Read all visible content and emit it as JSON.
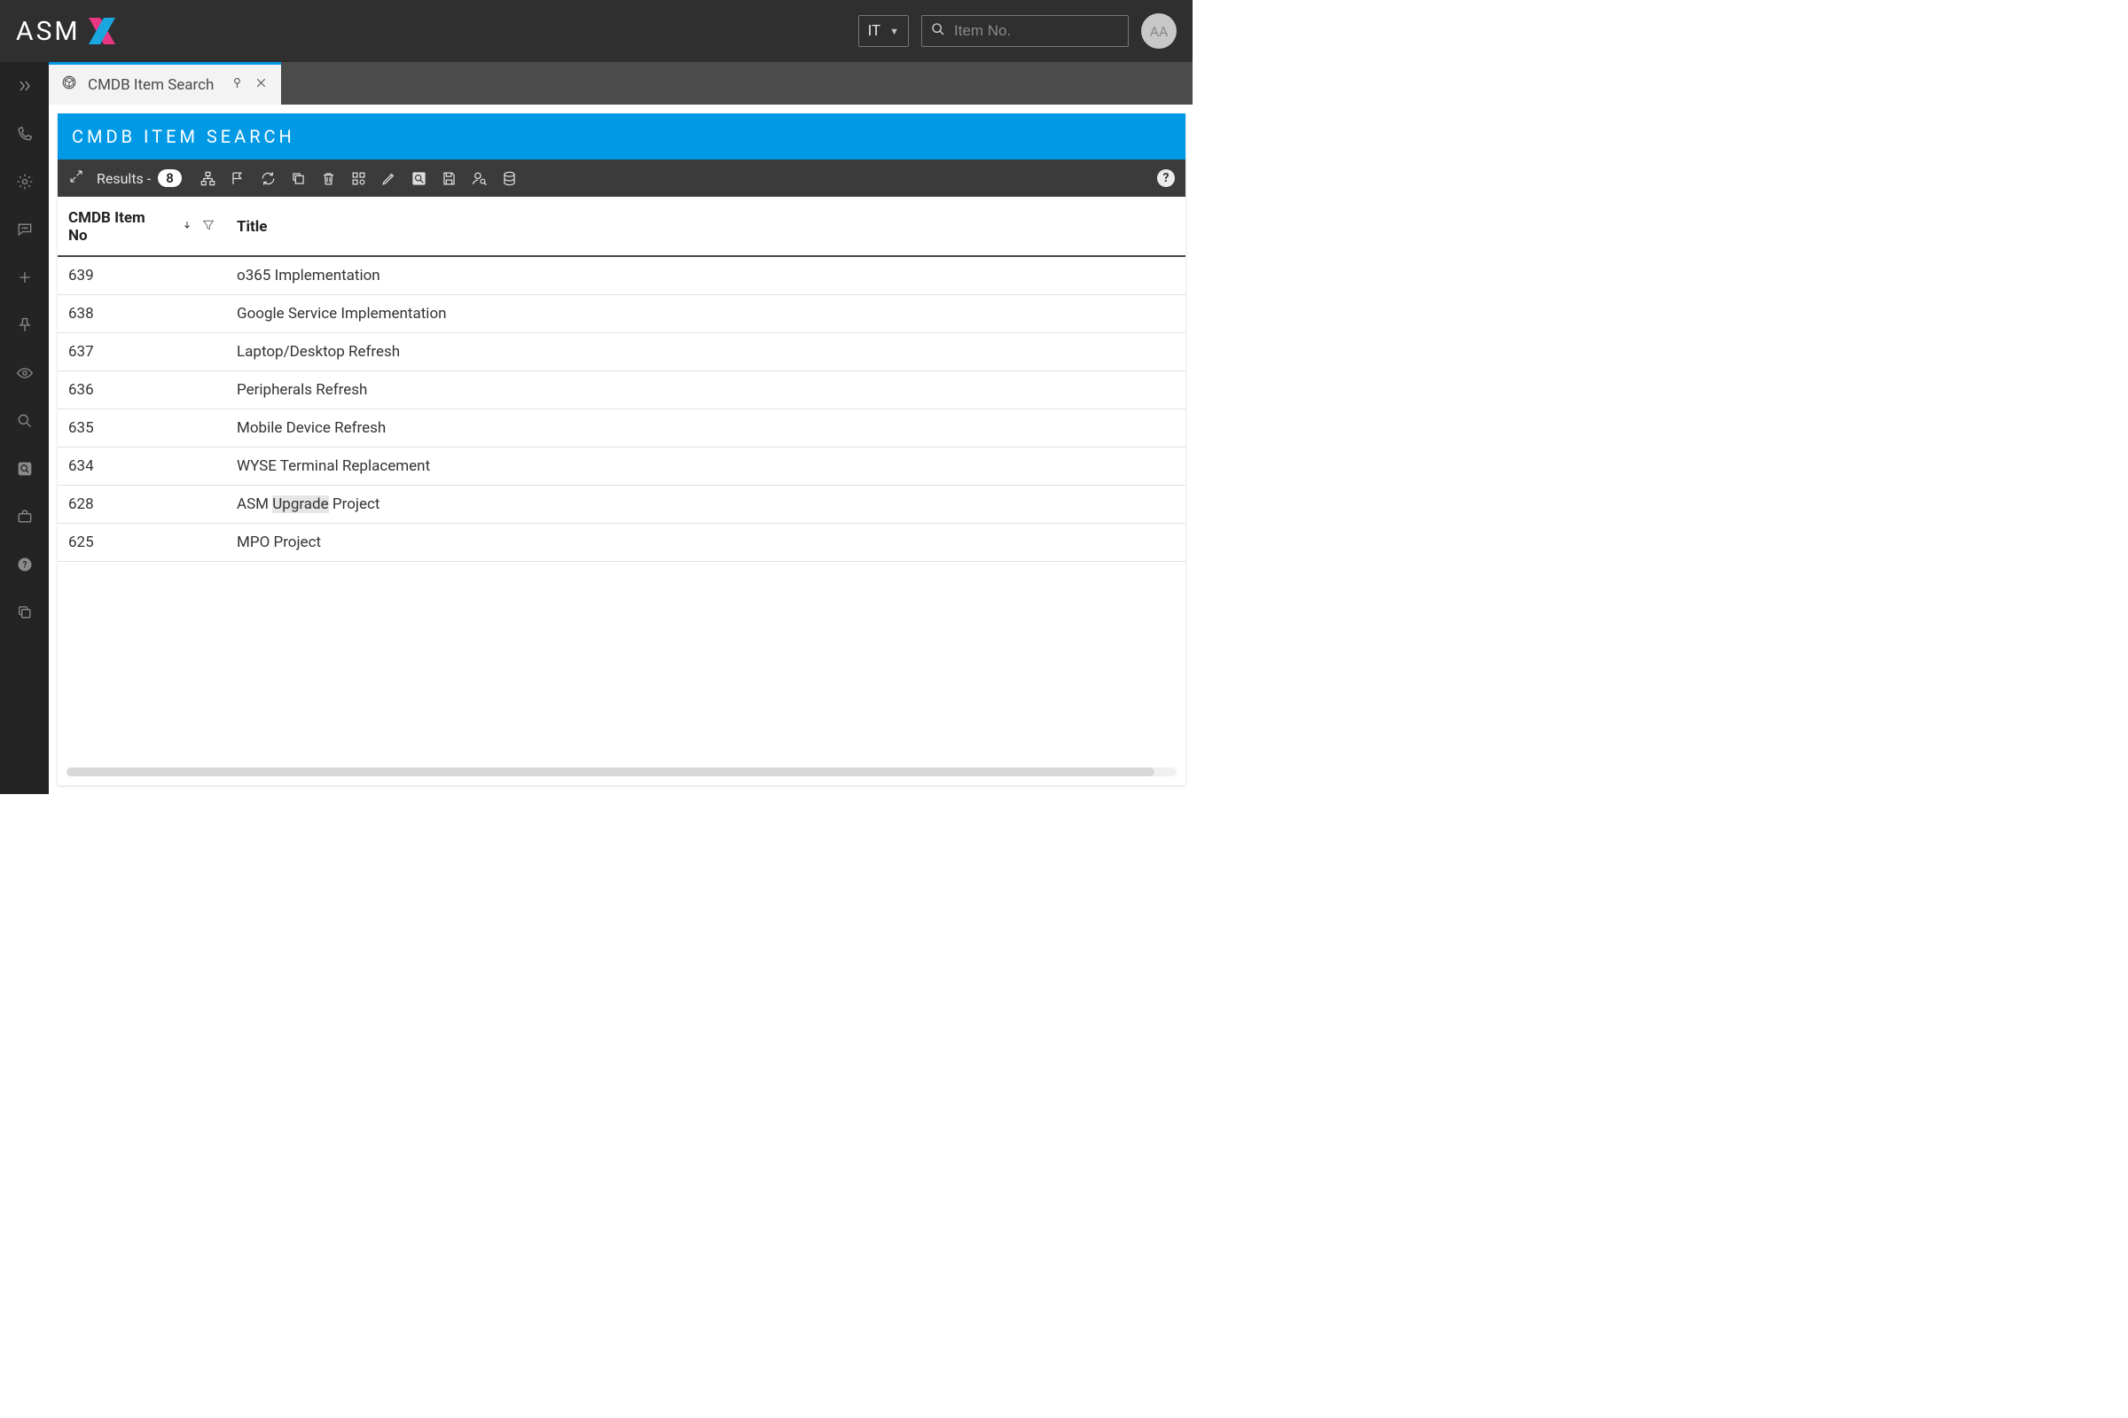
{
  "topbar": {
    "logo_text": "ASM",
    "dropdown_value": "IT",
    "search_placeholder": "Item No.",
    "avatar_initials": "AA"
  },
  "tab": {
    "label": "CMDB Item Search"
  },
  "panel": {
    "title": "CMDB ITEM SEARCH"
  },
  "toolbar": {
    "results_label": "Results -",
    "results_count": "8"
  },
  "table": {
    "columns": {
      "no": "CMDB Item No",
      "title": "Title"
    },
    "rows": [
      {
        "no": "639",
        "title": "o365 Implementation"
      },
      {
        "no": "638",
        "title": "Google Service Implementation"
      },
      {
        "no": "637",
        "title": "Laptop/Desktop Refresh"
      },
      {
        "no": "636",
        "title": "Peripherals Refresh"
      },
      {
        "no": "635",
        "title": "Mobile Device Refresh"
      },
      {
        "no": "634",
        "title": "WYSE Terminal Replacement"
      },
      {
        "no": "628",
        "title_parts": [
          "ASM ",
          "Upgrade",
          " Project"
        ],
        "highlight_index": 1
      },
      {
        "no": "625",
        "title": "MPO Project"
      }
    ]
  }
}
